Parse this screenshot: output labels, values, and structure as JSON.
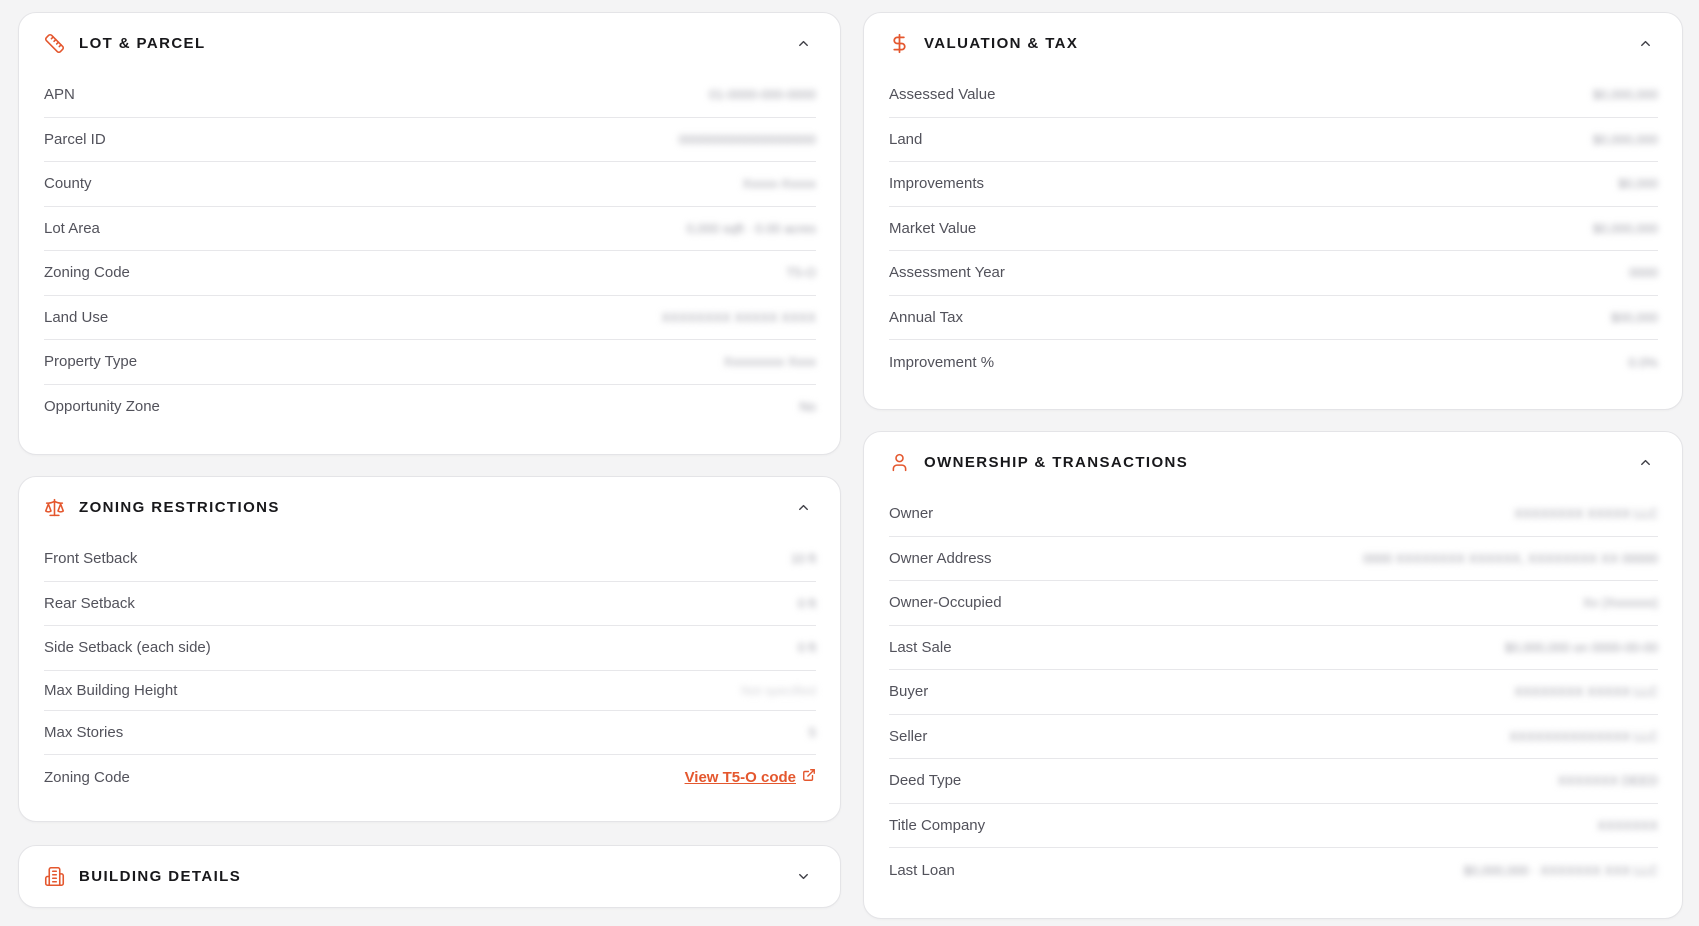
{
  "colors": {
    "accent": "#e4572e",
    "card_bg": "#ffffff",
    "page_bg": "#f4f4f5"
  },
  "lot_parcel": {
    "title": "LOT & PARCEL",
    "icon": "ruler-icon",
    "rows": [
      {
        "label": "APN",
        "value": "01-0000-000-0000"
      },
      {
        "label": "Parcel ID",
        "value": "0000000000000000000"
      },
      {
        "label": "County",
        "value": "Xxxxx-Xxxxx"
      },
      {
        "label": "Lot Area",
        "value": "0,000 sqft · 0.00 acres"
      },
      {
        "label": "Zoning Code",
        "value": "T5-O"
      },
      {
        "label": "Land Use",
        "value": "XXXXXXXX XXXXX XXXX"
      },
      {
        "label": "Property Type",
        "value": "Xxxxxxxxx Xxxx"
      },
      {
        "label": "Opportunity Zone",
        "value": "No"
      }
    ]
  },
  "zoning": {
    "title": "ZONING RESTRICTIONS",
    "icon": "scale-icon",
    "rows": [
      {
        "label": "Front Setback",
        "value": "10 ft"
      },
      {
        "label": "Rear Setback",
        "value": "0 ft"
      },
      {
        "label": "Side Setback (each side)",
        "value": "0 ft"
      },
      {
        "label": "Max Building Height",
        "value": "Not specified"
      },
      {
        "label": "Max Stories",
        "value": "5"
      }
    ],
    "code_label": "Zoning Code",
    "code_link": "View T5-O code"
  },
  "building": {
    "title": "BUILDING DETAILS",
    "icon": "building-icon"
  },
  "valuation": {
    "title": "VALUATION & TAX",
    "icon": "dollar-icon",
    "rows": [
      {
        "label": "Assessed Value",
        "value": "$0,000,000"
      },
      {
        "label": "Land",
        "value": "$0,000,000"
      },
      {
        "label": "Improvements",
        "value": "$0,000"
      },
      {
        "label": "Market Value",
        "value": "$0,000,000"
      },
      {
        "label": "Assessment Year",
        "value": "0000"
      },
      {
        "label": "Annual Tax",
        "value": "$00,000"
      },
      {
        "label": "Improvement %",
        "value": "0.0%"
      }
    ]
  },
  "ownership": {
    "title": "OWNERSHIP & TRANSACTIONS",
    "icon": "user-icon",
    "rows": [
      {
        "label": "Owner",
        "value": "XXXXXXXX XXXXX LLC"
      },
      {
        "label": "Owner Address",
        "value": "0000 XXXXXXXX XXXXXX, XXXXXXXX XX 00000"
      },
      {
        "label": "Owner-Occupied",
        "value": "Xx (Xxxxxxx)"
      },
      {
        "label": "Last Sale",
        "value": "$0,000,000 on 0000-00-00"
      },
      {
        "label": "Buyer",
        "value": "XXXXXXXX XXXXX LLC"
      },
      {
        "label": "Seller",
        "value": "XXXXXXXXXXXXXX LLC"
      },
      {
        "label": "Deed Type",
        "value": "XXXXXXX DEED"
      },
      {
        "label": "Title Company",
        "value": "XXXXXXX"
      },
      {
        "label": "Last Loan",
        "value": "$0,000,000 · XXXXXXX XXX LLC"
      }
    ]
  }
}
